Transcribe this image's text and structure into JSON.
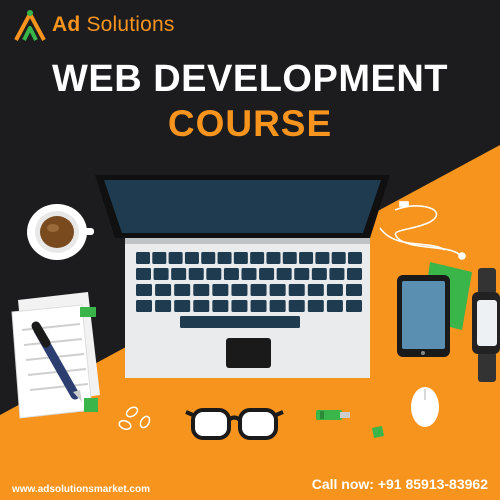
{
  "brand": {
    "name_bold": "Ad",
    "name_rest": " Solutions"
  },
  "title": {
    "line1": "WEB DEVELOPMENT",
    "line2": "COURSE"
  },
  "footer": {
    "website": "www.adsolutionsmarket.com",
    "phone": "Call now: +91 85913-83962"
  },
  "colors": {
    "accent": "#f7941d",
    "dark": "#1c1c1e",
    "green": "#3ab54a"
  },
  "icons": [
    "logo-icon",
    "laptop-icon",
    "coffee-cup-icon",
    "notepad-icon",
    "pen-icon",
    "earphones-icon",
    "phone-icon",
    "smartwatch-icon",
    "glasses-icon",
    "usb-drive-icon",
    "mouse-icon",
    "paperclip-icon"
  ]
}
